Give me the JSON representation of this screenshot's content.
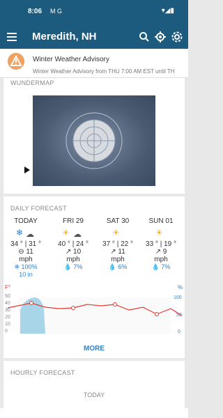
{
  "status_bar": {
    "time": "8:06",
    "left_icons": "M G",
    "right_icons": "▾◢▮"
  },
  "app_bar": {
    "title": "Meredith, NH",
    "icons": [
      "menu-icon",
      "search-icon",
      "location-icon",
      "settings-icon"
    ]
  },
  "alert": {
    "title": "Winter Weather Advisory",
    "subtitle": "Winter Weather Advisory from THU 7:00 AM EST until TH"
  },
  "wundermap": {
    "title": "WUNDERMAP"
  },
  "daily": {
    "title": "DAILY FORECAST",
    "days": [
      {
        "label": "TODAY",
        "temp": "34 ° | 31 °",
        "wind": "11",
        "wind_unit": "mph",
        "precip": "100%",
        "snow": "10 in"
      },
      {
        "label": "FRI 29",
        "temp": "40 ° | 24 °",
        "wind": "10",
        "wind_unit": "mph",
        "precip": "7%"
      },
      {
        "label": "SAT 30",
        "temp": "37 ° | 22 °",
        "wind": "11",
        "wind_unit": "mph",
        "precip": "6%"
      },
      {
        "label": "SUN 01",
        "temp": "33 ° | 19 °",
        "wind": "9",
        "wind_unit": "mph",
        "precip": "7%"
      }
    ],
    "axis_left_unit": "F°",
    "axis_right_unit": "%",
    "axis_left_ticks": [
      "50",
      "40",
      "30",
      "20",
      "10",
      "0"
    ],
    "axis_right_ticks": [
      "100",
      "50",
      "0"
    ],
    "more": "MORE"
  },
  "hourly": {
    "title": "HOURLY FORECAST",
    "today": "TODAY"
  },
  "colors": {
    "primary": "#1d5b7e",
    "accent": "#2a82c9",
    "temp_line": "#e53935",
    "precip_fill": "#9fd0e6"
  }
}
